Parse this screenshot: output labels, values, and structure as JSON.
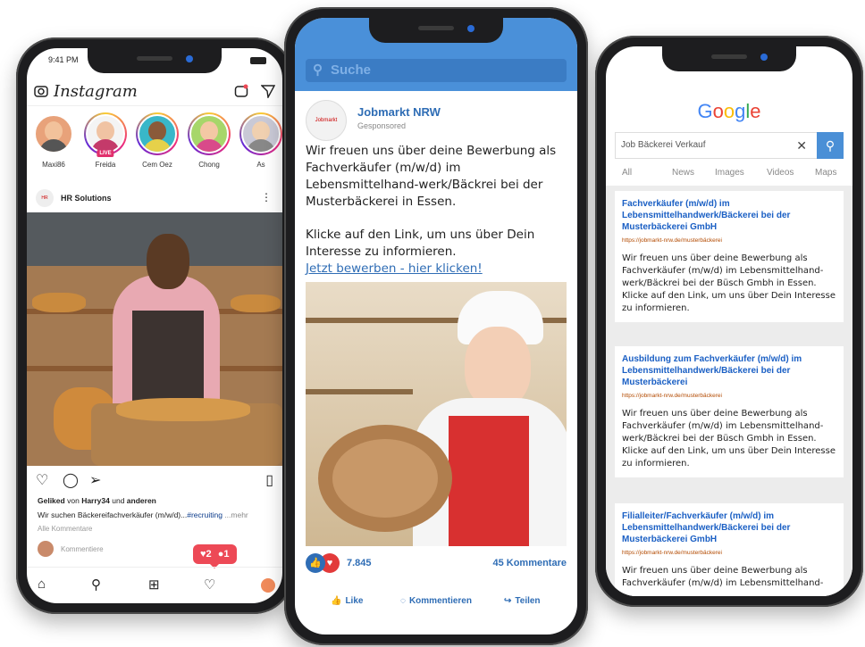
{
  "instagram": {
    "time": "9:41 PM",
    "app_name": "Instagram",
    "stories": [
      {
        "name": "Maxi86",
        "live": false
      },
      {
        "name": "Freida",
        "live": true
      },
      {
        "name": "Cem Oez",
        "live": false
      },
      {
        "name": "Chong",
        "live": false
      },
      {
        "name": "As",
        "live": false
      }
    ],
    "live_label": "LIVE",
    "post_account": "HR Solutions",
    "liked_prefix": "Geliked",
    "liked_by_word": "von",
    "liked_user": "Harry34",
    "liked_and": "und",
    "liked_others": "anderen",
    "caption": "Wir suchen Bäckereifachverkäufer (m/w/d)...",
    "hashtag": "#recruiting",
    "more": "...mehr",
    "all_comments": "Alle Kommentare",
    "comment_placeholder": "Kommentiere",
    "notif_hearts": "2",
    "notif_comments": "1"
  },
  "facebook": {
    "search_placeholder": "Suche",
    "page_name": "Jobmarkt NRW",
    "sponsored": "Gesponsored",
    "logo_text": "Jobmarkt",
    "text_p1": "Wir freuen uns über deine Bewerbung als Fachverkäufer (m/w/d) im Lebensmittelhand-werk/Bäckrei bei der Musterbäckerei in Essen.",
    "text_p2": "Klicke auf den Link, um uns über Dein Interesse zu informieren.",
    "link": "Jetzt bewerben - hier klicken!",
    "reactions": "7.845",
    "comments": "45 Kommentare",
    "actions": {
      "like": "Like",
      "comment": "Kommentieren",
      "share": "Teilen"
    }
  },
  "google": {
    "query": "Job Bäckerei Verkauf",
    "tabs": [
      "All",
      "News",
      "Images",
      "Videos",
      "Maps"
    ],
    "results": [
      {
        "title": "Fachverkäufer (m/w/d) im Lebensmittelhandwerk/Bäckerei bei der Musterbäckerei GmbH",
        "url": "https://jobmarkt-nrw.de/musterbäckerei",
        "desc": "Wir freuen uns über deine Bewerbung als Fachverkäufer (m/w/d) im Lebensmittelhand-werk/Bäckrei bei der Büsch Gmbh in Essen. Klicke auf den Link, um uns über Dein Interesse zu informieren."
      },
      {
        "title": "Ausbildung zum Fachverkäufer (m/w/d) im Lebensmittelhandwerk/Bäckerei bei der Musterbäckerei",
        "url": "https://jobmarkt-nrw.de/musterbäckerei",
        "desc": "Wir freuen uns über deine Bewerbung als Fachverkäufer (m/w/d) im Lebensmittelhand-werk/Bäckrei bei der Büsch Gmbh in Essen. Klicke auf den Link, um uns über Dein Interesse zu informieren."
      },
      {
        "title": "Filialleiter/Fachverkäufer (m/w/d) im Lebensmittelhandwerk/Bäckerei bei der Musterbäckerei GmbH",
        "url": "https://jobmarkt-nrw.de/musterbäckerei",
        "desc": "Wir freuen uns über deine Bewerbung als Fachverkäufer (m/w/d) im Lebensmittelhand-"
      }
    ]
  },
  "colors": {
    "facebook_blue": "#4a90d9",
    "link_blue": "#2f6db5",
    "instagram_red": "#ed4956",
    "google_blue": "#4285f4"
  }
}
